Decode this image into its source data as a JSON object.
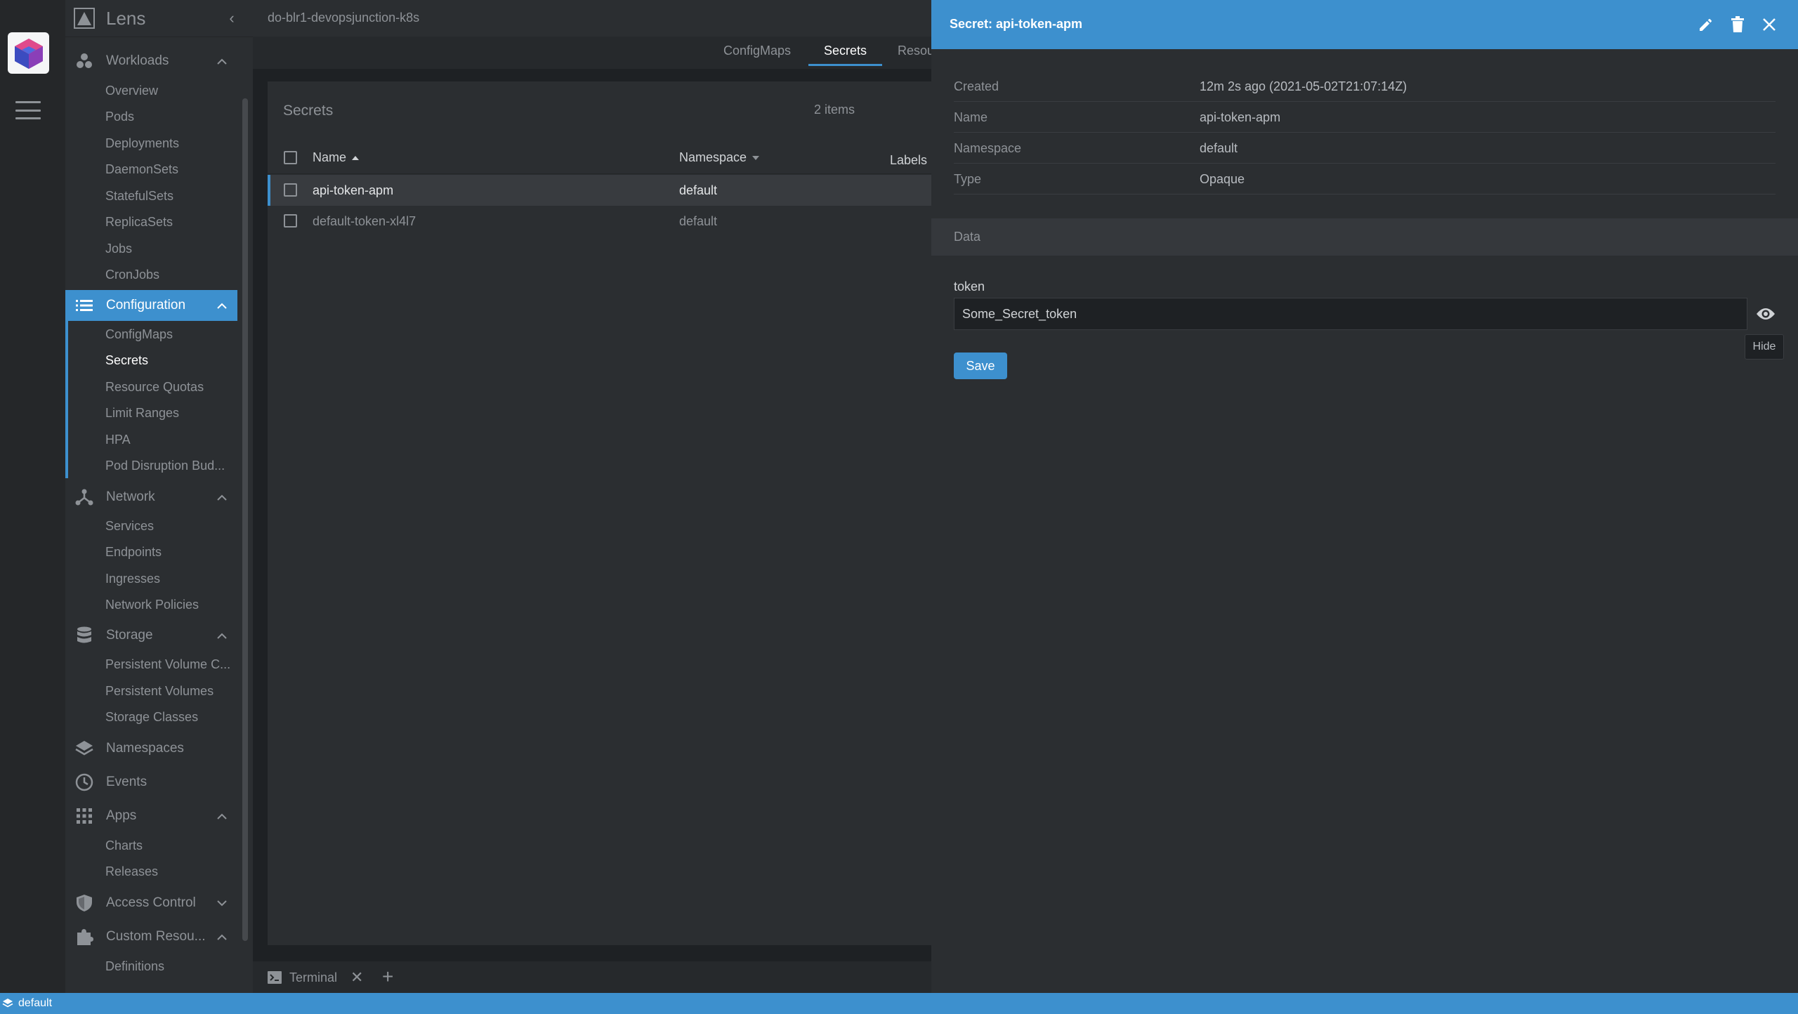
{
  "sidebar": {
    "title": "Lens",
    "groups": {
      "workloads": "Workloads",
      "configuration": "Configuration",
      "network": "Network",
      "storage": "Storage",
      "namespaces": "Namespaces",
      "events": "Events",
      "apps": "Apps",
      "access_control": "Access Control",
      "custom_resources": "Custom Resou..."
    },
    "workloads_items": [
      "Overview",
      "Pods",
      "Deployments",
      "DaemonSets",
      "StatefulSets",
      "ReplicaSets",
      "Jobs",
      "CronJobs"
    ],
    "configuration_items": [
      "ConfigMaps",
      "Secrets",
      "Resource Quotas",
      "Limit Ranges",
      "HPA",
      "Pod Disruption Bud..."
    ],
    "network_items": [
      "Services",
      "Endpoints",
      "Ingresses",
      "Network Policies"
    ],
    "storage_items": [
      "Persistent Volume C...",
      "Persistent Volumes",
      "Storage Classes"
    ],
    "apps_items": [
      "Charts",
      "Releases"
    ],
    "custom_resources_items": [
      "Definitions"
    ]
  },
  "topbar": {
    "cluster": "do-blr1-devopsjunction-k8s"
  },
  "tabs": [
    "ConfigMaps",
    "Secrets",
    "Resou"
  ],
  "list": {
    "title": "Secrets",
    "count": "2 items",
    "columns": {
      "name": "Name",
      "namespace": "Namespace",
      "labels": "Labels"
    },
    "rows": [
      {
        "name": "api-token-apm",
        "namespace": "default"
      },
      {
        "name": "default-token-xl4l7",
        "namespace": "default"
      }
    ]
  },
  "terminal": {
    "label": "Terminal",
    "close": "✕",
    "add": "+"
  },
  "drawer": {
    "title": "Secret: api-token-apm",
    "details": [
      {
        "key": "Created",
        "value": "12m 2s ago (2021-05-02T21:07:14Z)"
      },
      {
        "key": "Name",
        "value": "api-token-apm"
      },
      {
        "key": "Namespace",
        "value": "default"
      },
      {
        "key": "Type",
        "value": "Opaque"
      }
    ],
    "section": "Data",
    "field_label": "token",
    "field_value": "Some_Secret_token",
    "tooltip": "Hide",
    "save": "Save"
  },
  "statusbar": {
    "namespace": "default"
  },
  "colors": {
    "accent": "#3d90ce",
    "sidebar": "#2b2e31",
    "background": "#1e2124"
  }
}
